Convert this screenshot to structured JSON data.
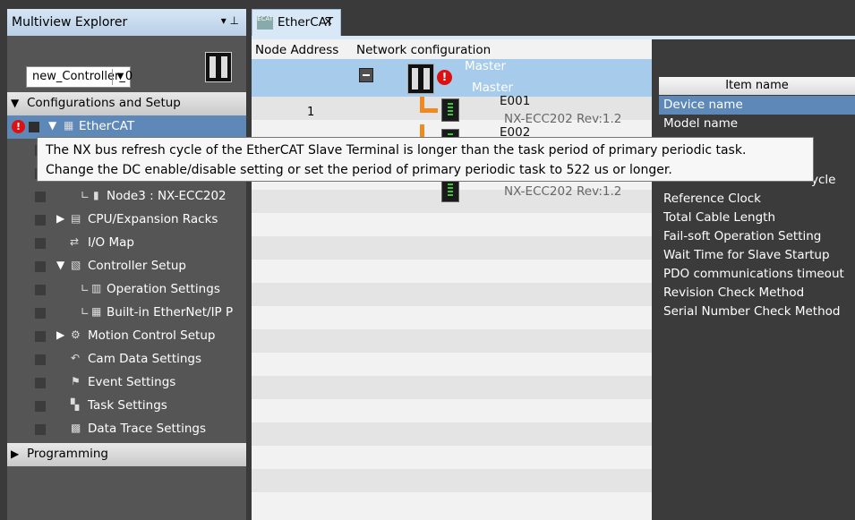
{
  "explorer": {
    "title": "Multiview Explorer",
    "pin_icon": "▾ ꟸ",
    "controller": {
      "selected": "new_Controller_0"
    },
    "tree": [
      {
        "label": "Configurations and Setup"
      },
      {
        "label": "EtherCAT"
      },
      {
        "label": "Node3 : NX-ECC202"
      },
      {
        "label": "CPU/Expansion Racks"
      },
      {
        "label": "I/O Map"
      },
      {
        "label": "Controller Setup"
      },
      {
        "label": "Operation Settings"
      },
      {
        "label": "Built-in EtherNet/IP P"
      },
      {
        "label": "Motion Control Setup"
      },
      {
        "label": "Cam Data Settings"
      },
      {
        "label": "Event Settings"
      },
      {
        "label": "Task Settings"
      },
      {
        "label": "Data Trace Settings"
      },
      {
        "label": "Programming"
      }
    ]
  },
  "editor": {
    "tab_label": "EtherCAT",
    "tab_close": "×",
    "tab_icon_text": "ECAT",
    "columns": {
      "node_address": "Node Address",
      "network_configuration": "Network configuration"
    },
    "master": {
      "label_top": "Master",
      "label_bottom": "Master"
    },
    "slaves": [
      {
        "address": "1",
        "name": "E001",
        "model": "NX-ECC202 Rev:1.2"
      },
      {
        "address": "",
        "name": "E002",
        "model": ""
      },
      {
        "address": "",
        "name": "",
        "model": "NX-ECC202 Rev:1.2"
      }
    ]
  },
  "properties": {
    "header": "Item name",
    "items": [
      "Device name",
      "Model name",
      "ycle",
      "Reference Clock",
      "Total Cable Length",
      "Fail-soft Operation Setting",
      "Wait Time for Slave Startup",
      "PDO communications timeout",
      "Revision Check Method",
      "Serial Number Check Method"
    ]
  },
  "tooltip": {
    "line1": "The NX bus refresh cycle of the EtherCAT Slave Terminal is longer than the task period of primary periodic task.",
    "line2": "Change the DC enable/disable setting or set the period of primary periodic task to 522 us or longer."
  },
  "colors": {
    "selection": "#5e88b8",
    "master_row": "#a7cbea",
    "error": "#dd1111",
    "network_line": "#f08a20"
  }
}
